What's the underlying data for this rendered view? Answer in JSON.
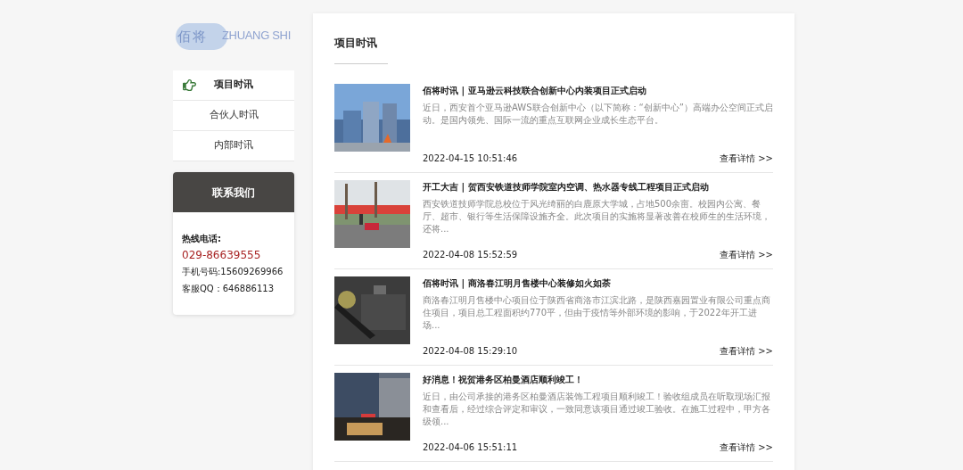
{
  "logo": {
    "mark": "佰将",
    "wordmark": "ZHUANG SHI"
  },
  "nav": [
    {
      "label": "项目时讯",
      "selected": true
    },
    {
      "label": "合伙人时讯",
      "selected": false
    },
    {
      "label": "内部时讯",
      "selected": false
    }
  ],
  "contact": {
    "title": "联系我们",
    "hotline_label": "热线电话:",
    "hotline": "029-86639555",
    "mobile": "手机号码:15609269966",
    "qq": "客服QQ：646886113"
  },
  "section_title": "项目时讯",
  "articles": [
    {
      "title": "佰将时讯 | 亚马逊云科技联合创新中心内装项目正式启动",
      "summary": "近日，西安首个亚马逊AWS联合创新中心（以下简称：“创新中心”）高端办公空间正式启动。是国内领先、国际一流的重点互联网企业成长生态平台。",
      "date": "2022-04-15 10:51:46",
      "more": "查看详情 >>"
    },
    {
      "title": "开工大吉 | 贺西安铁道技师学院室内空调、热水器专线工程项目正式启动",
      "summary": "西安铁道技师学院总校位于风光绮丽的白鹿原大学城，占地500余亩。校园内公寓、餐厅、超市、银行等生活保障设施齐全。此次项目的实施将显著改善在校师生的生活环境，还将...",
      "date": "2022-04-08 15:52:59",
      "more": "查看详情 >>"
    },
    {
      "title": "佰将时讯 | 商洛春江明月售楼中心装修如火如荼",
      "summary": "商洛春江明月售楼中心项目位于陕西省商洛市江滨北路，是陕西嘉园置业有限公司重点商住项目，项目总工程面积约770平，但由于疫情等外部环境的影响，于2022年开工进场...",
      "date": "2022-04-08 15:29:10",
      "more": "查看详情 >>"
    },
    {
      "title": "好消息！祝贺港务区柏曼酒店顺利竣工！",
      "summary": "近日，由公司承接的港务区柏曼酒店装饰工程项目顺利竣工！验收组成员在听取现场汇报和查看后，经过综合评定和审议，一致同意该项目通过竣工验收。在施工过程中，甲方各级领...",
      "date": "2022-04-06 15:51:11",
      "more": "查看详情 >>"
    }
  ]
}
